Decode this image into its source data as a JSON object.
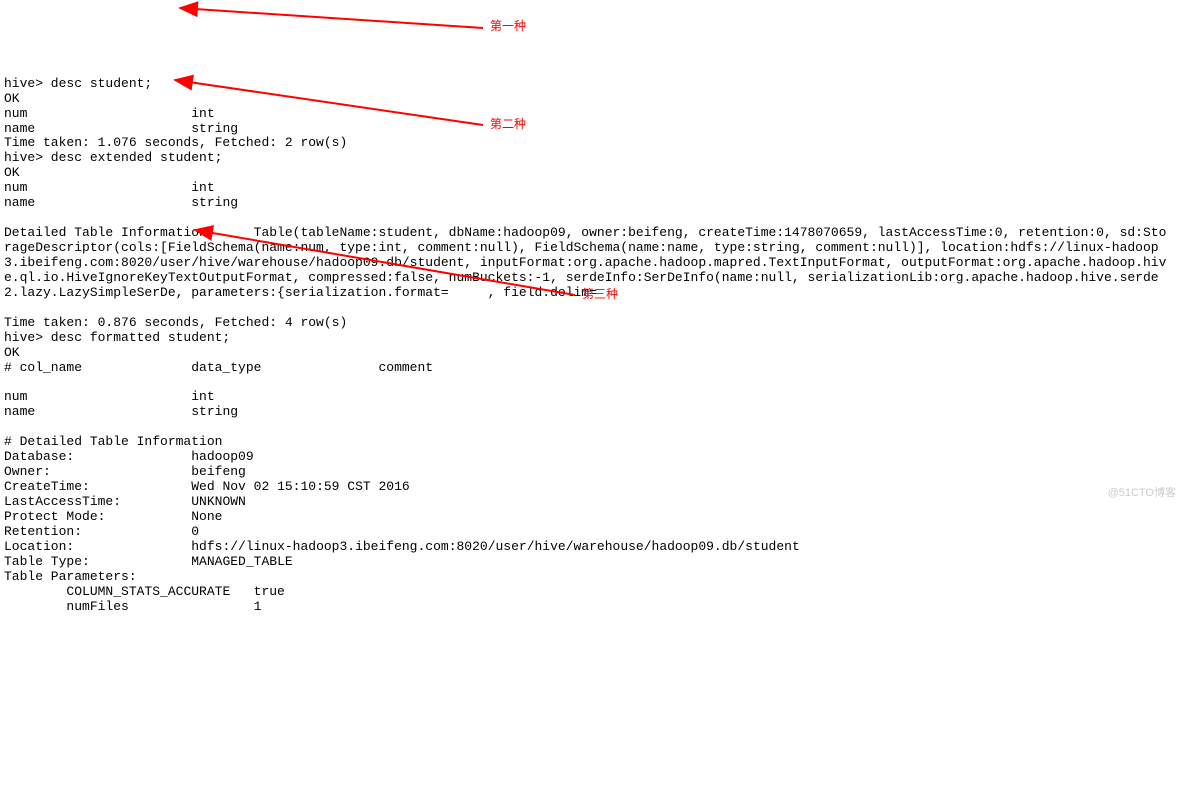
{
  "annotations": {
    "first": "第一种",
    "second": "第二种",
    "third": "第三种"
  },
  "watermark": "@51CTO博客",
  "session": {
    "prompt1": "hive> desc student;",
    "ok1": "OK",
    "cols1": [
      {
        "name": "num",
        "type": "int"
      },
      {
        "name": "name",
        "type": "string"
      }
    ],
    "time1": "Time taken: 1.076 seconds, Fetched: 2 row(s)",
    "prompt2": "hive> desc extended student;",
    "ok2": "OK",
    "cols2": [
      {
        "name": "num",
        "type": "int"
      },
      {
        "name": "name",
        "type": "string"
      }
    ],
    "detailed_table_info": "Detailed Table Information      Table(tableName:student, dbName:hadoop09, owner:beifeng, createTime:1478070659, lastAccessTime:0, retention:0, sd:StorageDescriptor(cols:[FieldSchema(name:num, type:int, comment:null), FieldSchema(name:name, type:string, comment:null)], location:hdfs://linux-hadoop3.ibeifeng.com:8020/user/hive/warehouse/hadoop09.db/student, inputFormat:org.apache.hadoop.mapred.TextInputFormat, outputFormat:org.apache.hadoop.hive.ql.io.HiveIgnoreKeyTextOutputFormat, compressed:false, numBuckets:-1, serdeInfo:SerDeInfo(name:null, serializationLib:org.apache.hadoop.hive.serde2.lazy.LazySimpleSerDe, parameters:{serialization.format=     , field.delim=",
    "time2": "Time taken: 0.876 seconds, Fetched: 4 row(s)",
    "prompt3": "hive> desc formatted student;",
    "ok3": "OK",
    "header3": "# col_name              data_type               comment",
    "blank": "",
    "cols3": [
      {
        "name": "num",
        "type": "int"
      },
      {
        "name": "name",
        "type": "string"
      }
    ],
    "detail_header": "# Detailed Table Information",
    "details": [
      {
        "k": "Database:",
        "v": "hadoop09"
      },
      {
        "k": "Owner:",
        "v": "beifeng"
      },
      {
        "k": "CreateTime:",
        "v": "Wed Nov 02 15:10:59 CST 2016"
      },
      {
        "k": "LastAccessTime:",
        "v": "UNKNOWN"
      },
      {
        "k": "Protect Mode:",
        "v": "None"
      },
      {
        "k": "Retention:",
        "v": "0"
      },
      {
        "k": "Location:",
        "v": "hdfs://linux-hadoop3.ibeifeng.com:8020/user/hive/warehouse/hadoop09.db/student"
      },
      {
        "k": "Table Type:",
        "v": "MANAGED_TABLE"
      }
    ],
    "table_params_header": "Table Parameters:",
    "table_params": [
      {
        "k": "COLUMN_STATS_ACCURATE",
        "v": "true"
      },
      {
        "k": "numFiles",
        "v": "1"
      }
    ]
  }
}
